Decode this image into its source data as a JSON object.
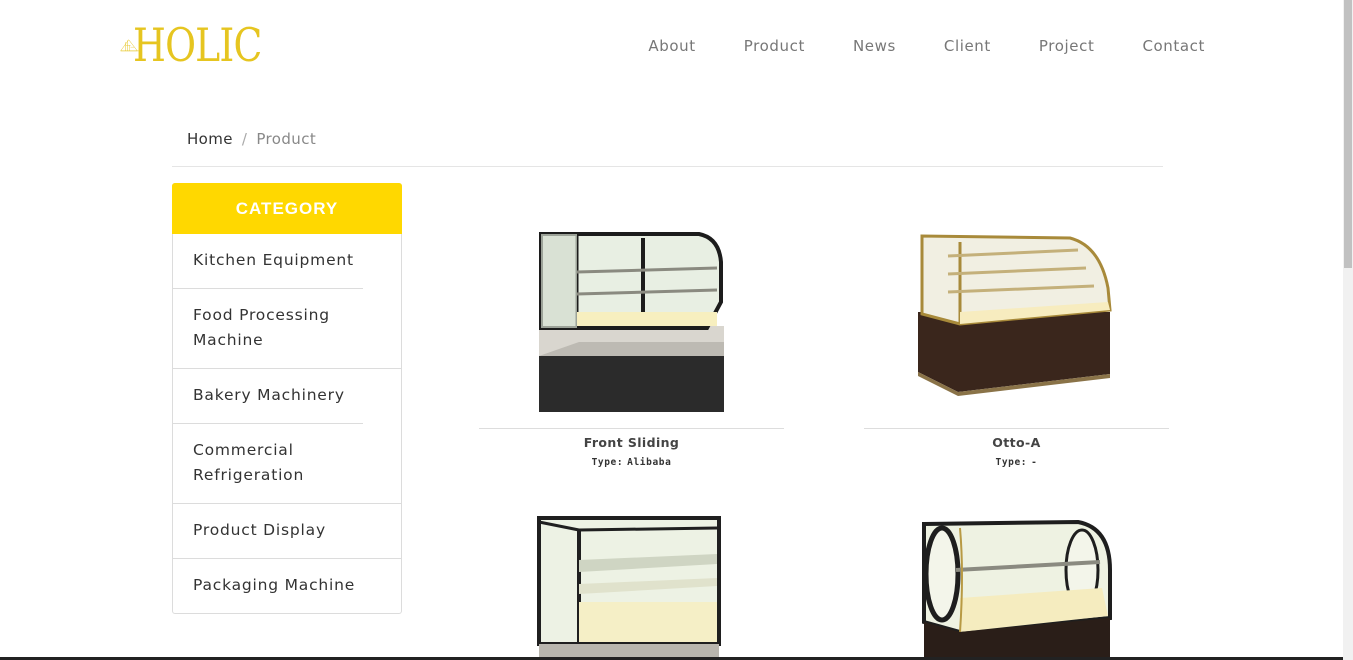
{
  "brand": {
    "logo_text": "HOLIC",
    "color": "#e6c520"
  },
  "nav": {
    "items": [
      "About",
      "Product",
      "News",
      "Client",
      "Project",
      "Contact"
    ]
  },
  "breadcrumb": {
    "home": "Home",
    "separator": "/",
    "current": "Product"
  },
  "sidebar": {
    "header": "CATEGORY",
    "header_color": "#ffd800",
    "items": [
      "Kitchen Equipment",
      "Food Processing Machine",
      "Bakery Machinery",
      "Commercial Refrigeration",
      "Product Display",
      "Packaging Machine"
    ]
  },
  "products": [
    {
      "name": "Front Sliding",
      "type_label": "Type:",
      "type_value": "Alibaba",
      "image": "display-case-silver-icon"
    },
    {
      "name": "Otto-A",
      "type_label": "Type:",
      "type_value": "-",
      "image": "display-case-brown-gold-icon"
    },
    {
      "name": "",
      "type_label": "",
      "type_value": "",
      "image": "display-case-square-icon"
    },
    {
      "name": "",
      "type_label": "",
      "type_value": "",
      "image": "display-case-round-icon"
    }
  ]
}
